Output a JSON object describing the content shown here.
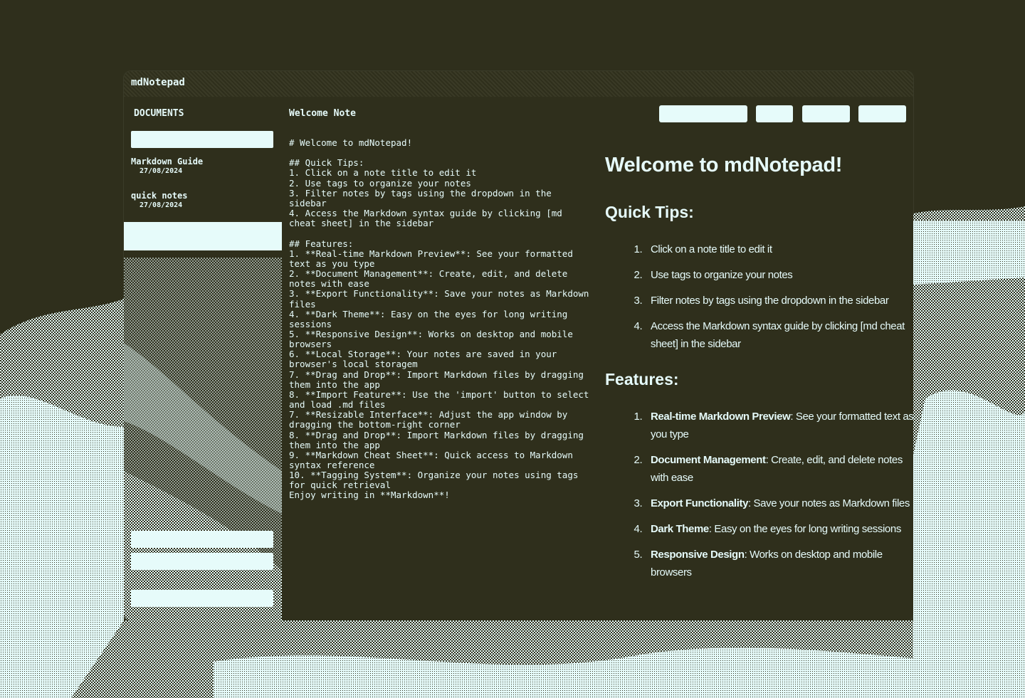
{
  "app": {
    "title": "mdNotepad"
  },
  "sidebar": {
    "header": "DOCUMENTS",
    "search_placeholder": "",
    "documents": [
      {
        "title": "Markdown Guide",
        "date": "27/08/2024"
      },
      {
        "title": "quick notes",
        "date": "27/08/2024"
      }
    ]
  },
  "editor": {
    "note_title": "Welcome Note",
    "source_lines": [
      "# Welcome to mdNotepad!",
      "",
      "## Quick Tips:",
      "1. Click on a note title to edit it",
      "2. Use tags to organize your notes",
      "3. Filter notes by tags using the dropdown in the sidebar",
      "4. Access the Markdown syntax guide by clicking [md cheat sheet] in the sidebar",
      "",
      "## Features:",
      "1. **Real-time Markdown Preview**: See your formatted text as you type",
      "2. **Document Management**: Create, edit, and delete notes with ease",
      "3. **Export Functionality**: Save your notes as Markdown files",
      "4. **Dark Theme**: Easy on the eyes for long writing sessions",
      "5. **Responsive Design**: Works on desktop and mobile browsers",
      "6. **Local Storage**: Your notes are saved in your browser's local storagem",
      "7. **Drag and Drop**: Import Markdown files by dragging them into the app",
      "8. **Import Feature**: Use the 'import' button to select and load .md files",
      "7. **Resizable Interface**: Adjust the app window by dragging the bottom-right corner",
      "8. **Drag and Drop**: Import Markdown files by dragging them into the app",
      "9. **Markdown Cheat Sheet**: Quick access to Markdown syntax reference",
      "10. **Tagging System**: Organize your notes using tags for quick retrieval",
      "Enjoy writing in **Markdown**!"
    ]
  },
  "preview": {
    "h1": "Welcome to mdNotepad!",
    "quick_tips": {
      "heading": "Quick Tips:",
      "items": [
        "Click on a note title to edit it",
        "Use tags to organize your notes",
        "Filter notes by tags using the dropdown in the sidebar",
        "Access the Markdown syntax guide by clicking [md cheat sheet] in the sidebar"
      ]
    },
    "features": {
      "heading": "Features:",
      "items": [
        {
          "bold": "Real-time Markdown Preview",
          "text": ": See your formatted text as you type"
        },
        {
          "bold": "Document Management",
          "text": ": Create, edit, and delete notes with ease"
        },
        {
          "bold": "Export Functionality",
          "text": ": Save your notes as Markdown files"
        },
        {
          "bold": "Dark Theme",
          "text": ": Easy on the eyes for long writing sessions"
        },
        {
          "bold": "Responsive Design",
          "text": ": Works on desktop and mobile browsers"
        }
      ]
    }
  },
  "colors": {
    "background": "#2f2f1c",
    "foreground": "#e6fbfa"
  }
}
